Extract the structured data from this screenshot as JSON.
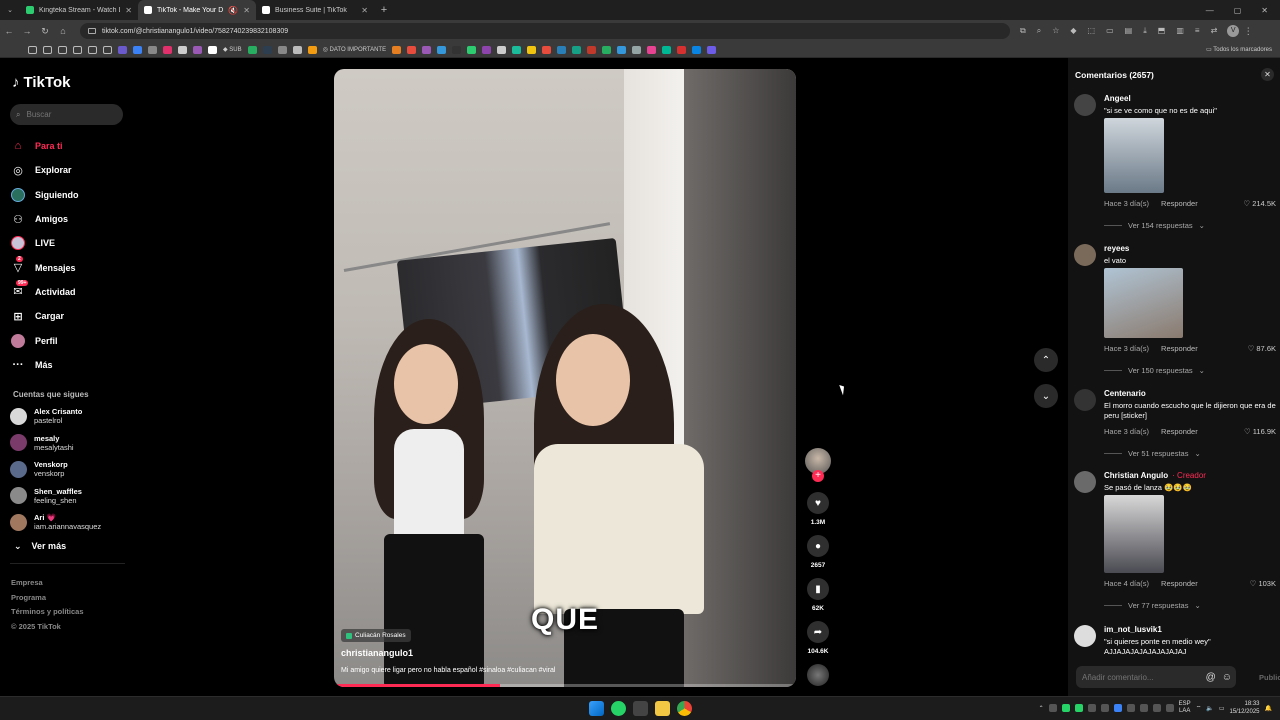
{
  "browser": {
    "tabs": [
      {
        "title": "Kingteka Stream - Watch Live o",
        "color": "#2ecc71",
        "active": false
      },
      {
        "title": "TikTok - Make Your Day",
        "color": "#ffffff",
        "active": true
      },
      {
        "title": "Business Suite | TikTok",
        "color": "#ffffff",
        "active": false
      }
    ],
    "url": "tiktok.com/@christianangulo1/video/7582740239832108309",
    "bookmarks": {
      "folder_label_1": "SUB",
      "folder_label_2": "DATO IMPORTANTE",
      "all_bookmarks": "Todos los marcadores"
    },
    "profile_initial": "V"
  },
  "tiktok": {
    "logo": "TikTok",
    "search_placeholder": "Buscar",
    "nav": [
      {
        "label": "Para ti",
        "icon": "⌂",
        "active": true
      },
      {
        "label": "Explorar",
        "icon": "◎",
        "active": false
      },
      {
        "label": "Siguiendo",
        "icon": "◉",
        "active": false
      },
      {
        "label": "Amigos",
        "icon": "⚇",
        "active": false
      },
      {
        "label": "LIVE",
        "icon": "●",
        "active": false
      },
      {
        "label": "Mensajes",
        "icon": "▽",
        "badge": "2",
        "active": false
      },
      {
        "label": "Actividad",
        "icon": "✉",
        "badge": "99+",
        "active": false
      },
      {
        "label": "Cargar",
        "icon": "⊞",
        "active": false
      },
      {
        "label": "Perfil",
        "icon": "●",
        "active": false
      },
      {
        "label": "Más",
        "icon": "···",
        "active": false
      }
    ],
    "following_title": "Cuentas que sigues",
    "following": [
      {
        "name": "Alex Crisanto",
        "handle": "pastelrol",
        "color": "#d8d8d8"
      },
      {
        "name": "mesaly",
        "handle": "mesalytashi",
        "color": "#7a3a6a"
      },
      {
        "name": "Venskorp",
        "handle": "venskorp",
        "color": "#5a6a8a"
      },
      {
        "name": "Shen_waffles",
        "handle": "feeling_shen",
        "color": "#8a8a8a"
      },
      {
        "name": "Ari 💗",
        "handle": "iam.ariannavasquez",
        "color": "#a07860"
      }
    ],
    "see_more": "Ver más",
    "footer": [
      "Empresa",
      "Programa",
      "Términos y políticas",
      "© 2025 TikTok"
    ]
  },
  "video": {
    "caption_overlay": "QUE",
    "location": "Culiacán Rosales",
    "author": "christianangulo1",
    "description": "Mi amigo quiere ligar pero no habla español #sinaloa #culiacan #viral",
    "progress": 0.36,
    "actions": {
      "likes": "1.3M",
      "comments": "2657",
      "saves": "62K",
      "shares": "104.6K"
    }
  },
  "comments": {
    "header": "Comentarios (2657)",
    "items": [
      {
        "name": "Angeel",
        "creator": "",
        "text": "\"si se ve como que no es de aqui\"",
        "time": "Hace 3 día(s)",
        "reply": "Responder",
        "likes": "214.5K",
        "replies": "Ver 154 respuestas",
        "avatar_color": "#444"
      },
      {
        "name": "reyees",
        "creator": "",
        "text": "el vato",
        "time": "Hace 3 día(s)",
        "reply": "Responder",
        "likes": "87.6K",
        "replies": "Ver 150 respuestas",
        "avatar_color": "#7a6a5a"
      },
      {
        "name": "Centenario",
        "creator": "",
        "text": "El morro cuando escucho que le dijieron que era de peru [sticker]",
        "time": "Hace 3 día(s)",
        "reply": "Responder",
        "likes": "116.9K",
        "replies": "Ver 51 respuestas",
        "avatar_color": "#333"
      },
      {
        "name": "Christian Angulo",
        "creator": "· Creador",
        "text": "Se pasó de lanza 🥹🥹🥹",
        "time": "Hace 4 día(s)",
        "reply": "Responder",
        "likes": "103K",
        "replies": "Ver 77 respuestas",
        "avatar_color": "#6a6a6a"
      },
      {
        "name": "im_not_lusvik1",
        "creator": "",
        "text": "\"si quieres ponte en medio wey\" AJJAJAJAJAJAJAJAJAJ",
        "avatar_color": "#ddd"
      }
    ],
    "input_placeholder": "Añadir comentario...",
    "publish": "Publicar"
  },
  "taskbar": {
    "lang_top": "ESP",
    "lang_bottom": "LAA",
    "time": "18:33",
    "date": "15/12/2025"
  }
}
